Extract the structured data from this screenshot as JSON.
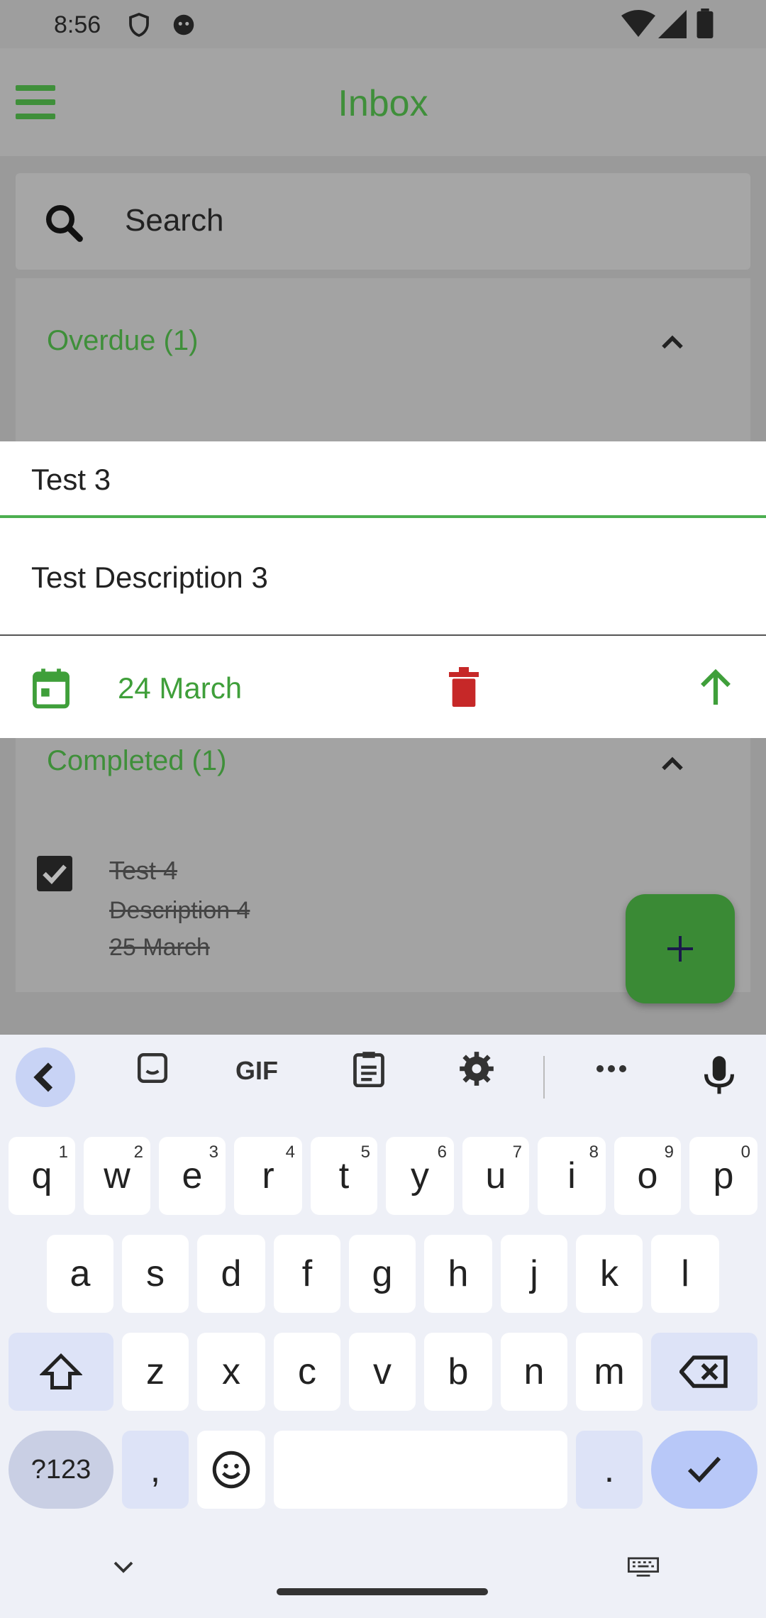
{
  "status_bar": {
    "time": "8:56"
  },
  "app_bar": {
    "title": "Inbox"
  },
  "search": {
    "placeholder": "Search"
  },
  "sections": {
    "overdue": {
      "label": "Overdue (1)"
    },
    "completed": {
      "label": "Completed (1)",
      "item": {
        "title": "Test  4",
        "description": "Description 4",
        "date": "25 March"
      }
    }
  },
  "editor": {
    "title_value": "Test 3",
    "description_value": "Test Description 3",
    "date_label": "24 March"
  },
  "keyboard": {
    "row1": [
      {
        "k": "q",
        "n": "1"
      },
      {
        "k": "w",
        "n": "2"
      },
      {
        "k": "e",
        "n": "3"
      },
      {
        "k": "r",
        "n": "4"
      },
      {
        "k": "t",
        "n": "5"
      },
      {
        "k": "y",
        "n": "6"
      },
      {
        "k": "u",
        "n": "7"
      },
      {
        "k": "i",
        "n": "8"
      },
      {
        "k": "o",
        "n": "9"
      },
      {
        "k": "p",
        "n": "0"
      }
    ],
    "row2": [
      "a",
      "s",
      "d",
      "f",
      "g",
      "h",
      "j",
      "k",
      "l"
    ],
    "row3": [
      "z",
      "x",
      "c",
      "v",
      "b",
      "n",
      "m"
    ],
    "symbols_label": "?123",
    "comma_label": ",",
    "period_label": ".",
    "gif_label": "GIF"
  },
  "colors": {
    "accent": "#3f8f3a",
    "danger": "#c62828"
  }
}
